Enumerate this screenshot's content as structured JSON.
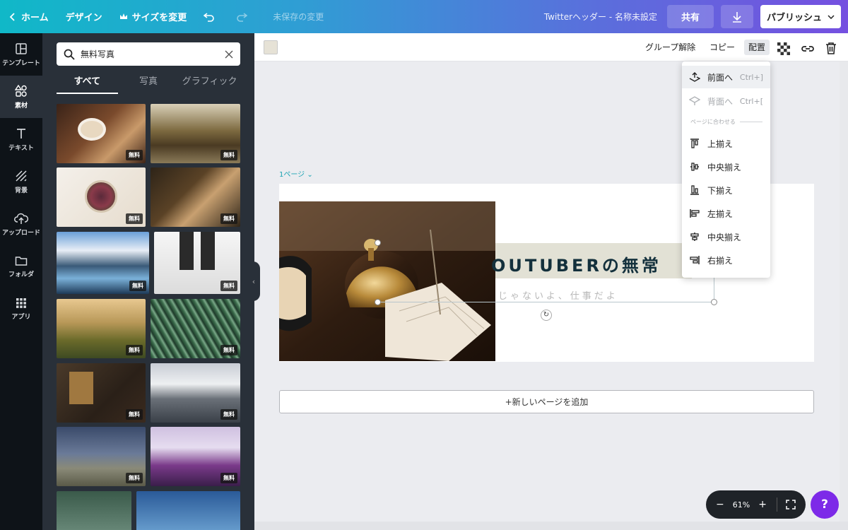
{
  "topbar": {
    "home": "ホーム",
    "design": "デザイン",
    "resize": "サイズを変更",
    "unsaved": "未保存の変更",
    "doc_title": "Twitterヘッダー - 名称未設定",
    "share": "共有",
    "publish": "パブリッシュ"
  },
  "nav": {
    "template": "テンプレート",
    "elements": "素材",
    "text": "テキスト",
    "background": "背景",
    "upload": "アップロード",
    "folder": "フォルダ",
    "apps": "アプリ"
  },
  "panel": {
    "search_value": "無料写真",
    "tabs": [
      "すべて",
      "写真",
      "グラフィック"
    ],
    "free_badge": "無料"
  },
  "toolbar": {
    "ungroup": "グループ解除",
    "copy": "コピー",
    "arrange": "配置",
    "swatch_color": "#e6e2d6"
  },
  "canvas": {
    "page_label": "1ページ",
    "headline": "OUTUBERの無常",
    "subline": "じゃないよ、仕事だよ",
    "add_page": "+新しいページを追加"
  },
  "dropdown": {
    "forward": "前面へ",
    "forward_shortcut": "Ctrl+]",
    "backward": "背面へ",
    "backward_shortcut": "Ctrl+[",
    "section": "ページに合わせる",
    "align_top": "上揃え",
    "align_middle": "中央揃え",
    "align_bottom": "下揃え",
    "align_left": "左揃え",
    "align_center": "中央揃え",
    "align_right": "右揃え"
  },
  "zoom": {
    "minus": "−",
    "value": "61%",
    "plus": "+"
  },
  "help": "?"
}
